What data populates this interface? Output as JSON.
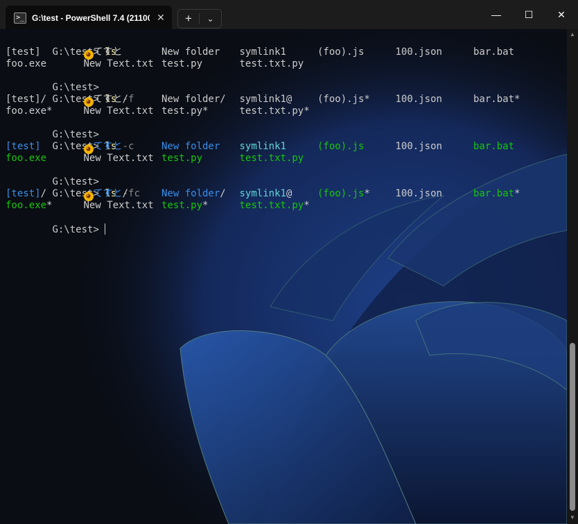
{
  "window": {
    "tab_title": "G:\\test - PowerShell 7.4 (21100",
    "tab_icon": "powershell-prompt-icon",
    "tab_icon_glyph": ">_",
    "close_tab_glyph": "✕",
    "new_tab_glyph": "+",
    "dropdown_glyph": "⌄",
    "minimize_glyph": "—",
    "maximize_glyph": "☐",
    "close_glyph": "✕"
  },
  "terminal": {
    "prompt": "G:\\test> ",
    "commands": {
      "c1": "ls",
      "c2_cmd": "ls",
      "c2_param": "-f",
      "c3_cmd": "ls",
      "c3_param": "-c",
      "c4_cmd": "ls",
      "c4_param": "-fc"
    },
    "listing_plain": {
      "row1": [
        "[test]",
        "てすと",
        "New folder",
        "symlink1",
        "(foo).js",
        "100.json",
        "bar.bat"
      ],
      "row2": [
        "foo.exe",
        "New Text.txt",
        "test.py",
        "test.txt.py"
      ]
    },
    "listing_f": {
      "row1": [
        "[test]/",
        "てすと/",
        "New folder/",
        "symlink1@",
        "(foo).js*",
        "100.json",
        "bar.bat*"
      ],
      "row2": [
        "foo.exe*",
        "New Text.txt",
        "test.py*",
        "test.txt.py*"
      ]
    },
    "listing_c": {
      "row1": [
        "[test]",
        "てすと",
        "New folder",
        "symlink1",
        "(foo).js",
        "100.json",
        "bar.bat"
      ],
      "row2": [
        "foo.exe",
        "New Text.txt",
        "test.py",
        "test.txt.py"
      ]
    },
    "listing_fc": {
      "row1_names": [
        "[test]",
        "てすと",
        "New folder",
        "symlink1",
        "(foo).js",
        "100.json",
        "bar.bat"
      ],
      "row1_suffix": [
        "/",
        "/",
        "/",
        "@",
        "*",
        "",
        "*"
      ],
      "row2_names": [
        "foo.exe",
        "New Text.txt",
        "test.py",
        "test.txt.py"
      ],
      "row2_suffix": [
        "*",
        "",
        "*",
        "*"
      ]
    },
    "emoji_icon": "grinning-face-icon"
  },
  "colors": {
    "directory": "#3b8eea",
    "symlink": "#61d6d6",
    "executable": "#16c60c",
    "command": "#f9f1a5",
    "parameter": "#8a8a8a",
    "text": "#cccccc",
    "background": "#0a0d14",
    "titlebar": "#1c1c1c"
  }
}
